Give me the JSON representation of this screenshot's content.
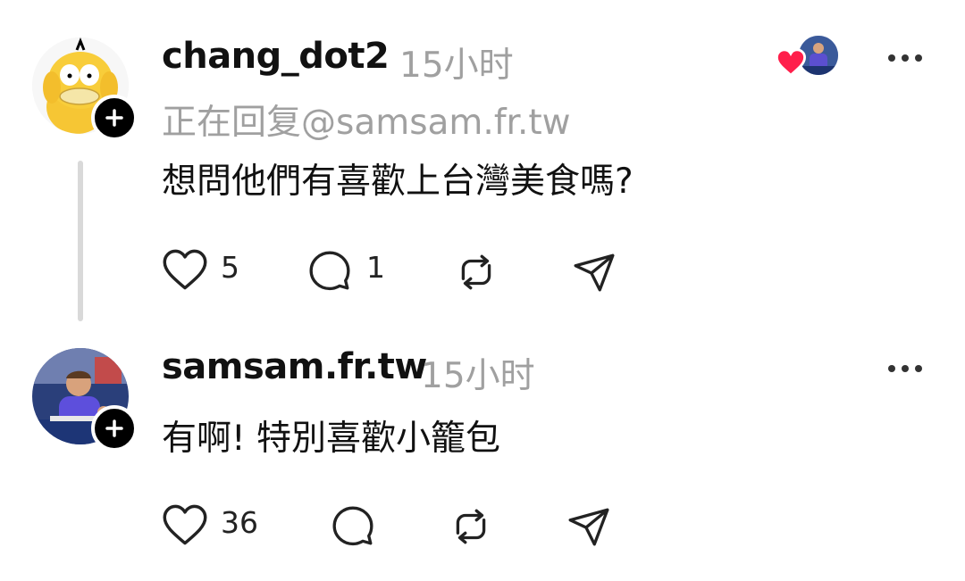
{
  "replies": [
    {
      "username": "chang_dot2",
      "time": "15小时",
      "reply_to": "正在回复@samsam.fr.tw",
      "text": "想問他們有喜歡上台灣美食嗎?",
      "likes": "5",
      "comments": "1",
      "liked_by_author": true,
      "icons": [
        "heart-icon",
        "comment-icon",
        "repost-icon",
        "share-icon",
        "more-icon",
        "follow-plus-icon"
      ]
    },
    {
      "username": "samsam.fr.tw",
      "time": "15小时",
      "text": "有啊! 特別喜歡小籠包",
      "likes": "36",
      "comments": "",
      "icons": [
        "heart-icon",
        "comment-icon",
        "repost-icon",
        "share-icon",
        "more-icon",
        "follow-plus-icon"
      ]
    }
  ],
  "colors": {
    "heart": "#ff1f4b",
    "muted": "#a0a0a0",
    "thread_line": "#d9d9d9"
  }
}
